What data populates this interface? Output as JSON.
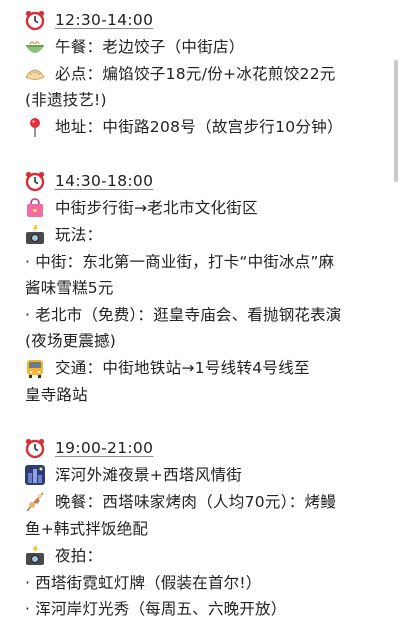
{
  "sections": [
    {
      "time": "12:30-14:00",
      "lines": [
        {
          "icon": "noodle-bowl-icon",
          "text": "午餐：老边饺子（中街店）"
        },
        {
          "icon": "dumpling-icon",
          "text": "必点：煸馅饺子18元/份+冰花煎饺22元",
          "cont": "(非遗技艺!)"
        },
        {
          "icon": "location-pin-icon",
          "text": "地址：中街路208号（故宫步行10分钟）"
        }
      ]
    },
    {
      "time": "14:30-18:00",
      "lines": [
        {
          "icon": "shopping-bag-icon",
          "text": "中街步行街→老北市文化街区"
        },
        {
          "icon": "camera-flash-icon",
          "text": "玩法："
        }
      ],
      "bullets": [
        {
          "text": "· 中街：东北第一商业街，打卡“中街冰点”麻",
          "cont": "酱味雪糕5元"
        },
        {
          "text": "· 老北市（免费）：逛皇寺庙会、看抛钢花表演",
          "cont": "(夜场更震撼)"
        }
      ],
      "transport": {
        "icon": "bus-icon",
        "text": "交通：中街地铁站→1号线转4号线至",
        "cont": "皇寺路站"
      }
    },
    {
      "time": "19:00-21:00",
      "lines": [
        {
          "icon": "city-night-icon",
          "text": "浑河外滩夜景+西塔风情街"
        },
        {
          "icon": "skewer-icon",
          "text": "晚餐：西塔味家烤肉（人均70元）：烤鳗",
          "cont": "鱼+韩式拌饭绝配"
        },
        {
          "icon": "camera-flash-icon",
          "text": "夜拍："
        }
      ],
      "bullets": [
        {
          "text": "· 西塔街霓虹灯牌（假装在首尔!）"
        },
        {
          "text": "· 浑河岸灯光秀（每周五、六晚开放）"
        }
      ]
    }
  ]
}
